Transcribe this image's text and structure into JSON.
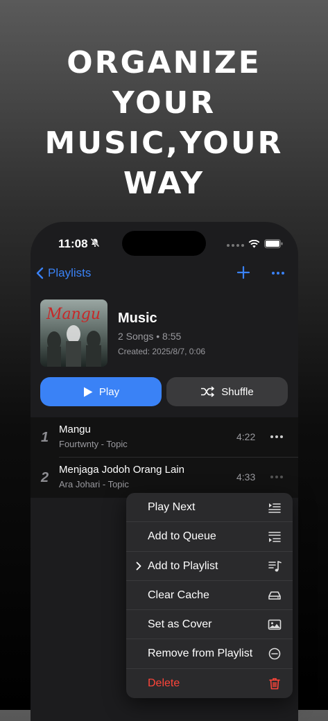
{
  "headline": [
    "ORGANIZE",
    "YOUR",
    "MUSIC,YOUR",
    "WAY"
  ],
  "status": {
    "time": "11:08"
  },
  "nav": {
    "back_label": "Playlists"
  },
  "playlist": {
    "title": "Music",
    "meta": "2 Songs • 8:55",
    "created": "Created: 2025/8/7, 0:06",
    "cover_text": "Mangu"
  },
  "buttons": {
    "play": "Play",
    "shuffle": "Shuffle"
  },
  "songs": [
    {
      "num": "1",
      "title": "Mangu",
      "artist": "Fourtwnty - Topic",
      "duration": "4:22"
    },
    {
      "num": "2",
      "title": "Menjaga Jodoh Orang Lain",
      "artist": "Ara Johari - Topic",
      "duration": "4:33"
    }
  ],
  "menu": [
    {
      "label": "Play Next",
      "icon": "play-next-icon"
    },
    {
      "label": "Add to Queue",
      "icon": "add-to-queue-icon"
    },
    {
      "label": "Add to Playlist",
      "icon": "music-list-icon"
    },
    {
      "label": "Clear Cache",
      "icon": "drive-icon"
    },
    {
      "label": "Set as Cover",
      "icon": "photo-icon"
    },
    {
      "label": "Remove from Playlist",
      "icon": "minus-circle-icon"
    },
    {
      "label": "Delete",
      "icon": "trash-icon"
    }
  ],
  "colors": {
    "accent": "#3a82f6",
    "danger": "#ff453a",
    "surface": "#1c1c1e"
  }
}
